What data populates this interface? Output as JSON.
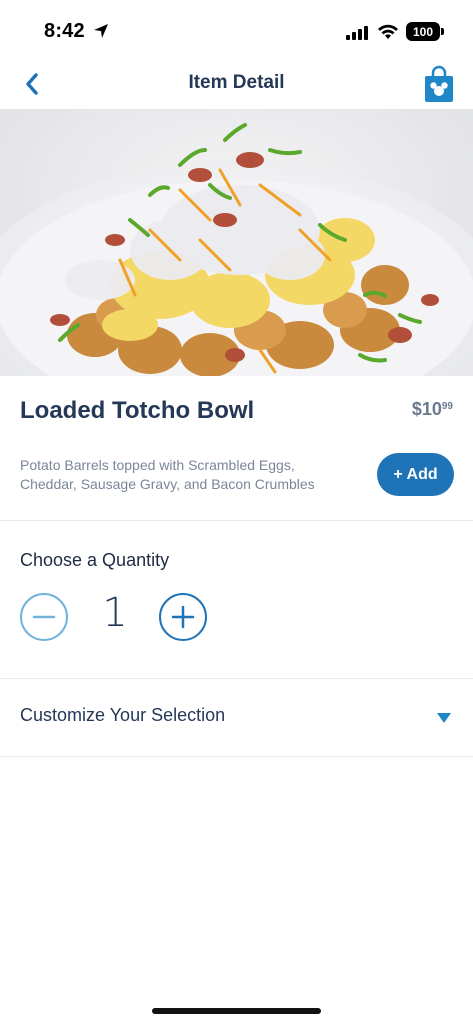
{
  "status_bar": {
    "time": "8:42",
    "battery": "100"
  },
  "nav": {
    "title": "Item Detail",
    "back_icon": "chevron-left-icon",
    "bag_icon": "shopping-bag-icon"
  },
  "item": {
    "name": "Loaded Totcho Bowl",
    "price_dollars": "$10",
    "price_cents": "99",
    "description": "Potato Barrels topped with Scrambled Eggs, Cheddar, Sausage Gravy, and Bacon Crumbles",
    "add_label": "+ Add"
  },
  "quantity": {
    "label": "Choose a Quantity",
    "value": "1"
  },
  "customize": {
    "label": "Customize Your Selection"
  },
  "colors": {
    "accent": "#1f73b7",
    "title": "#253858",
    "muted": "#7a8699"
  }
}
